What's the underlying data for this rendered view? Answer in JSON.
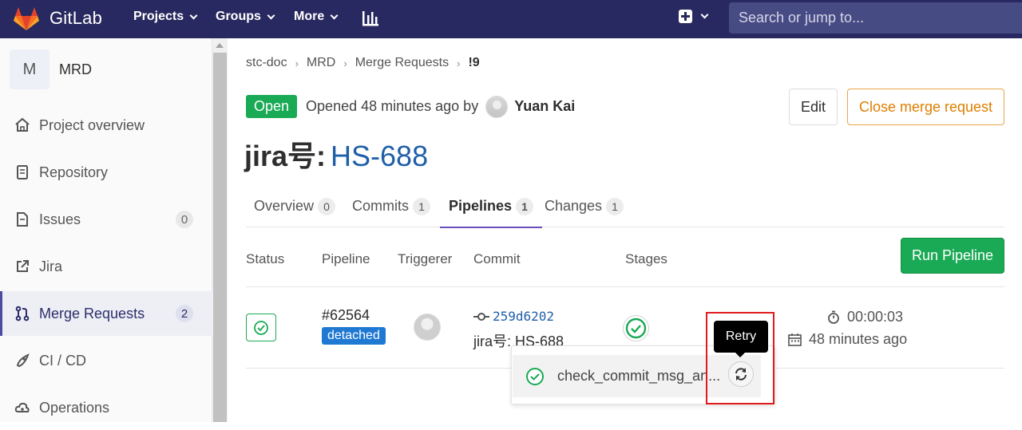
{
  "topnav": {
    "brand": "GitLab",
    "projects_label": "Projects",
    "groups_label": "Groups",
    "more_label": "More",
    "search_placeholder": "Search or jump to...",
    "bg_color": "#292961"
  },
  "sidebar": {
    "project_initial": "M",
    "project_name": "MRD",
    "items": [
      {
        "label": "Project overview",
        "icon": "home-icon"
      },
      {
        "label": "Repository",
        "icon": "document-icon"
      },
      {
        "label": "Issues",
        "icon": "issues-icon",
        "count": "0"
      },
      {
        "label": "Jira",
        "icon": "external-link-icon"
      },
      {
        "label": "Merge Requests",
        "icon": "merge-request-icon",
        "count": "2",
        "active": true
      },
      {
        "label": "CI / CD",
        "icon": "rocket-icon"
      },
      {
        "label": "Operations",
        "icon": "cloud-gear-icon"
      }
    ]
  },
  "breadcrumb": [
    "stc-doc",
    "MRD",
    "Merge Requests",
    "!9"
  ],
  "mr": {
    "status": "Open",
    "opened_text": "Opened 48 minutes ago by",
    "author": "Yuan Kai",
    "title_prefix": "jira号:",
    "title_ref": "HS-688",
    "edit_label": "Edit",
    "close_label": "Close merge request"
  },
  "tabs": [
    {
      "label": "Overview",
      "count": "0"
    },
    {
      "label": "Commits",
      "count": "1"
    },
    {
      "label": "Pipelines",
      "count": "1",
      "active": true
    },
    {
      "label": "Changes",
      "count": "1"
    }
  ],
  "pipelines": {
    "columns": [
      "Status",
      "Pipeline",
      "Triggerer",
      "Commit",
      "Stages"
    ],
    "run_button": "Run Pipeline",
    "rows": [
      {
        "id": "#62564",
        "tag": "detached",
        "sha": "259d6202",
        "message": "jira号: HS-688",
        "duration": "00:00:03",
        "finished": "48 minutes ago"
      }
    ]
  },
  "stage_dropdown": {
    "job_name": "check_commit_msg_an...",
    "tooltip": "Retry"
  },
  "colors": {
    "success": "#1aaa55",
    "link": "#1f5fa8",
    "warning": "#de7e00",
    "highlight": "#e11b1b"
  }
}
